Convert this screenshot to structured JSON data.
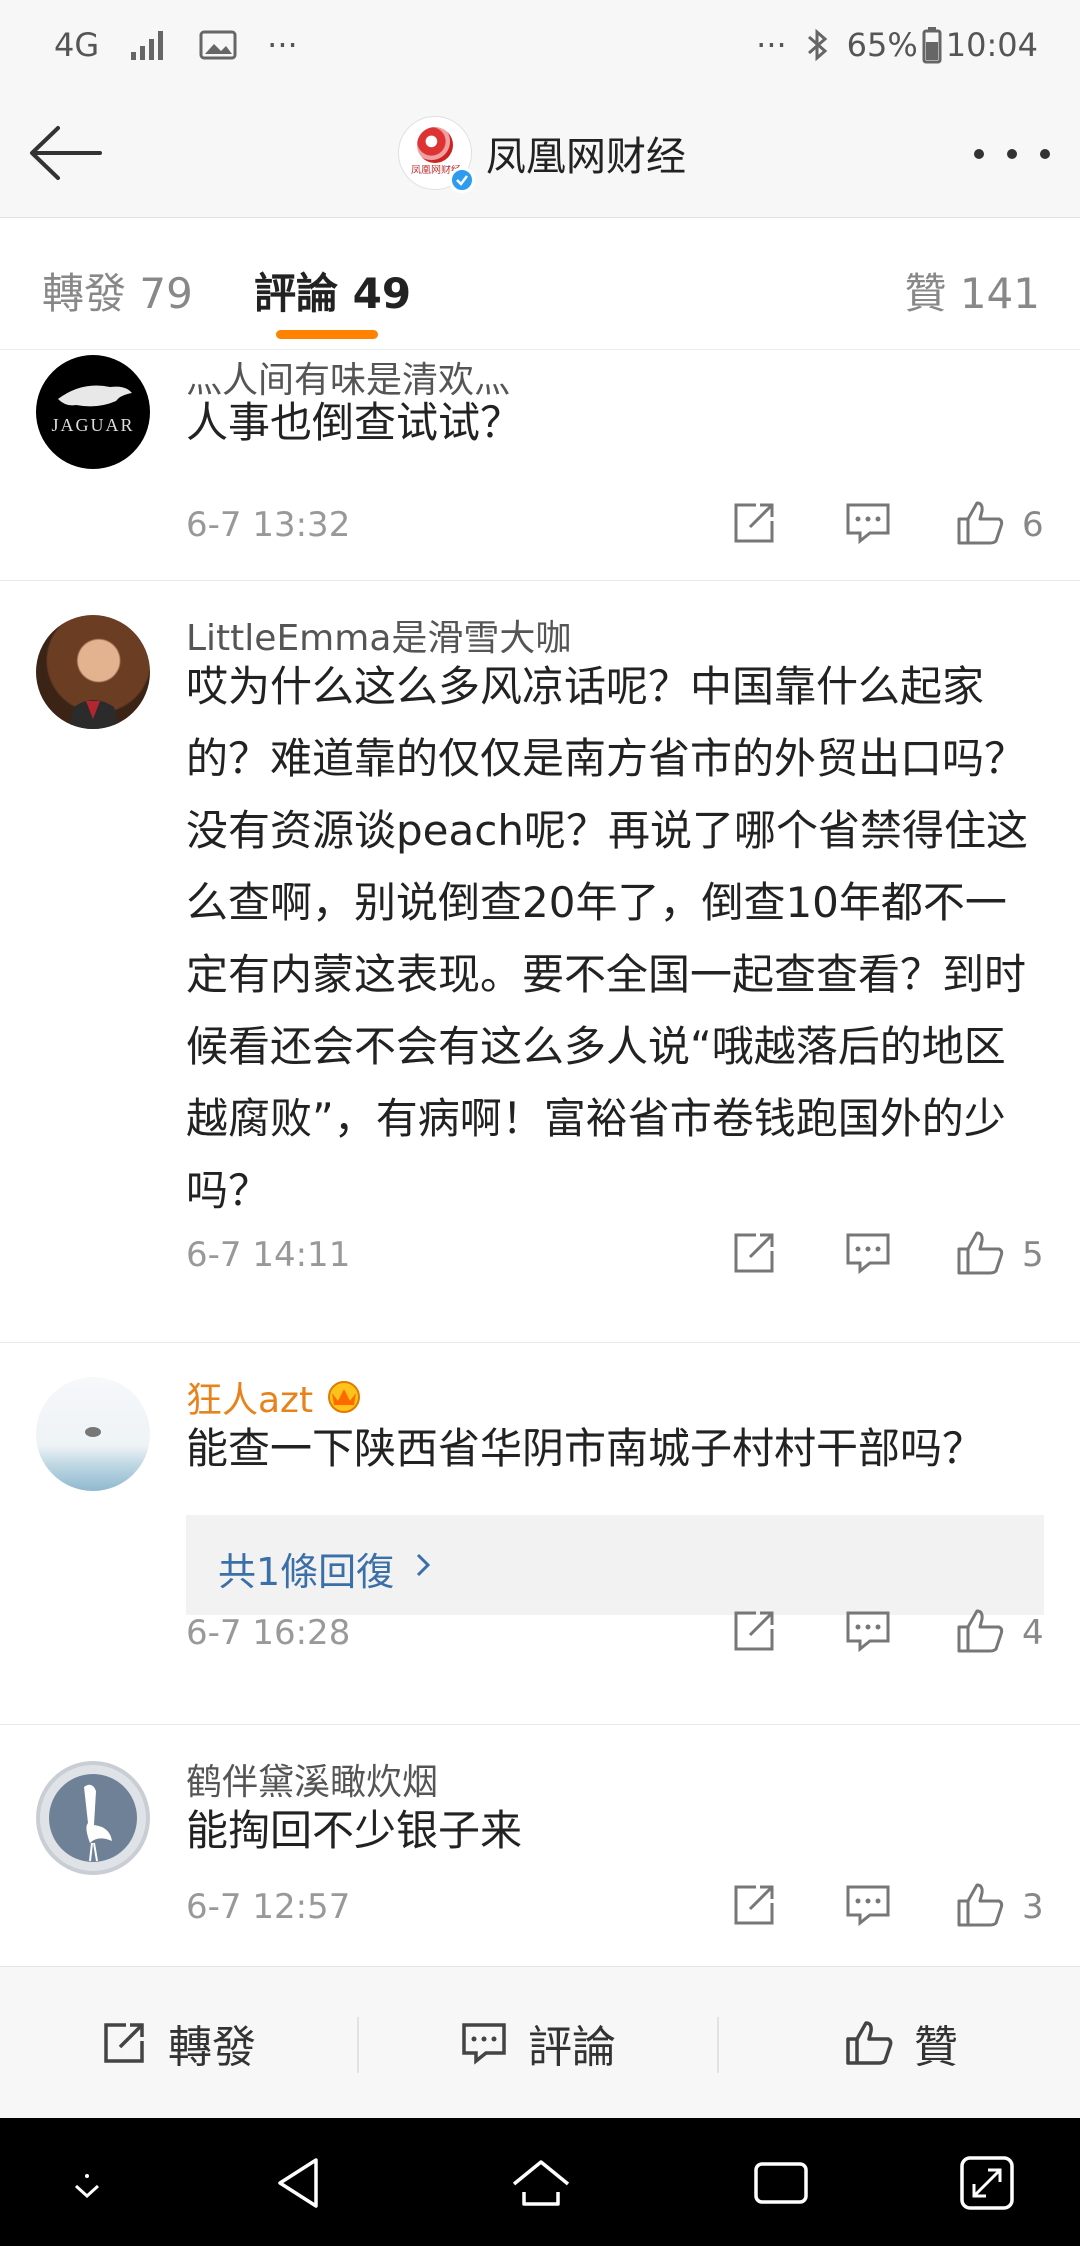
{
  "status_bar": {
    "network": "4G",
    "more_left": "···",
    "more_right": "···",
    "battery": "65%",
    "time": "10:04"
  },
  "header": {
    "account_name": "凤凰网财经",
    "logo_text": "凤凰网财经"
  },
  "tabs": {
    "repost": "轉發 79",
    "comments": "評論 49",
    "likes": "贊 141"
  },
  "comments": [
    {
      "username": "灬人间有味是清欢灬",
      "avatar_label": "JAGUAR",
      "text": "人事也倒查试试？",
      "time": "6-7 13:32",
      "likes": "6"
    },
    {
      "username": "LittleEmma是滑雪大咖",
      "text": "哎为什么这么多风凉话呢？中国靠什么起家的？难道靠的仅仅是南方省市的外贸出口吗？没有资源谈peach呢？再说了哪个省禁得住这么查啊，别说倒查20年了，倒查10年都不一定有内蒙这表现。要不全国一起查查看？到时候看还会不会有这么多人说“哦越落后的地区越腐败”，有病啊！富裕省市卷钱跑国外的少吗？",
      "time": "6-7 14:11",
      "likes": "5"
    },
    {
      "username": "狂人azt",
      "text": "能查一下陕西省华阴市南城子村村干部吗？",
      "replies": "共1條回復",
      "time": "6-7 16:28",
      "likes": "4"
    },
    {
      "username": "鹤伴黛溪瞰炊烟",
      "text": "能掏回不少银子来",
      "time": "6-7 12:57",
      "likes": "3"
    }
  ],
  "bottom_bar": {
    "repost": "轉發",
    "comment": "評論",
    "like": "贊"
  },
  "colors": {
    "accent": "#ff8200",
    "link": "#3a6fa8",
    "vip_name": "#e8821a"
  }
}
